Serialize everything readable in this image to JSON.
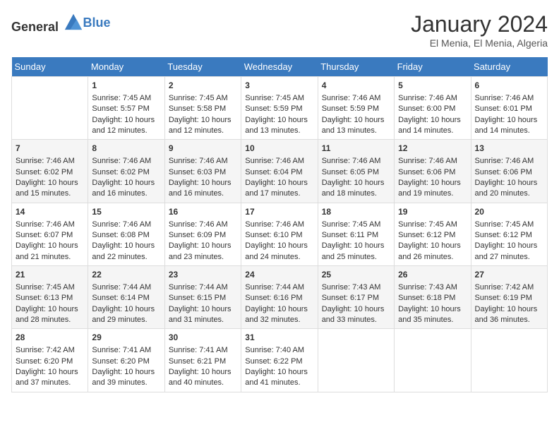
{
  "header": {
    "logo_general": "General",
    "logo_blue": "Blue",
    "month": "January 2024",
    "location": "El Menia, El Menia, Algeria"
  },
  "days_of_week": [
    "Sunday",
    "Monday",
    "Tuesday",
    "Wednesday",
    "Thursday",
    "Friday",
    "Saturday"
  ],
  "weeks": [
    [
      {
        "day": "",
        "sunrise": "",
        "sunset": "",
        "daylight": ""
      },
      {
        "day": "1",
        "sunrise": "Sunrise: 7:45 AM",
        "sunset": "Sunset: 5:57 PM",
        "daylight": "Daylight: 10 hours and 12 minutes."
      },
      {
        "day": "2",
        "sunrise": "Sunrise: 7:45 AM",
        "sunset": "Sunset: 5:58 PM",
        "daylight": "Daylight: 10 hours and 12 minutes."
      },
      {
        "day": "3",
        "sunrise": "Sunrise: 7:45 AM",
        "sunset": "Sunset: 5:59 PM",
        "daylight": "Daylight: 10 hours and 13 minutes."
      },
      {
        "day": "4",
        "sunrise": "Sunrise: 7:46 AM",
        "sunset": "Sunset: 5:59 PM",
        "daylight": "Daylight: 10 hours and 13 minutes."
      },
      {
        "day": "5",
        "sunrise": "Sunrise: 7:46 AM",
        "sunset": "Sunset: 6:00 PM",
        "daylight": "Daylight: 10 hours and 14 minutes."
      },
      {
        "day": "6",
        "sunrise": "Sunrise: 7:46 AM",
        "sunset": "Sunset: 6:01 PM",
        "daylight": "Daylight: 10 hours and 14 minutes."
      }
    ],
    [
      {
        "day": "7",
        "sunrise": "Sunrise: 7:46 AM",
        "sunset": "Sunset: 6:02 PM",
        "daylight": "Daylight: 10 hours and 15 minutes."
      },
      {
        "day": "8",
        "sunrise": "Sunrise: 7:46 AM",
        "sunset": "Sunset: 6:02 PM",
        "daylight": "Daylight: 10 hours and 16 minutes."
      },
      {
        "day": "9",
        "sunrise": "Sunrise: 7:46 AM",
        "sunset": "Sunset: 6:03 PM",
        "daylight": "Daylight: 10 hours and 16 minutes."
      },
      {
        "day": "10",
        "sunrise": "Sunrise: 7:46 AM",
        "sunset": "Sunset: 6:04 PM",
        "daylight": "Daylight: 10 hours and 17 minutes."
      },
      {
        "day": "11",
        "sunrise": "Sunrise: 7:46 AM",
        "sunset": "Sunset: 6:05 PM",
        "daylight": "Daylight: 10 hours and 18 minutes."
      },
      {
        "day": "12",
        "sunrise": "Sunrise: 7:46 AM",
        "sunset": "Sunset: 6:06 PM",
        "daylight": "Daylight: 10 hours and 19 minutes."
      },
      {
        "day": "13",
        "sunrise": "Sunrise: 7:46 AM",
        "sunset": "Sunset: 6:06 PM",
        "daylight": "Daylight: 10 hours and 20 minutes."
      }
    ],
    [
      {
        "day": "14",
        "sunrise": "Sunrise: 7:46 AM",
        "sunset": "Sunset: 6:07 PM",
        "daylight": "Daylight: 10 hours and 21 minutes."
      },
      {
        "day": "15",
        "sunrise": "Sunrise: 7:46 AM",
        "sunset": "Sunset: 6:08 PM",
        "daylight": "Daylight: 10 hours and 22 minutes."
      },
      {
        "day": "16",
        "sunrise": "Sunrise: 7:46 AM",
        "sunset": "Sunset: 6:09 PM",
        "daylight": "Daylight: 10 hours and 23 minutes."
      },
      {
        "day": "17",
        "sunrise": "Sunrise: 7:46 AM",
        "sunset": "Sunset: 6:10 PM",
        "daylight": "Daylight: 10 hours and 24 minutes."
      },
      {
        "day": "18",
        "sunrise": "Sunrise: 7:45 AM",
        "sunset": "Sunset: 6:11 PM",
        "daylight": "Daylight: 10 hours and 25 minutes."
      },
      {
        "day": "19",
        "sunrise": "Sunrise: 7:45 AM",
        "sunset": "Sunset: 6:12 PM",
        "daylight": "Daylight: 10 hours and 26 minutes."
      },
      {
        "day": "20",
        "sunrise": "Sunrise: 7:45 AM",
        "sunset": "Sunset: 6:12 PM",
        "daylight": "Daylight: 10 hours and 27 minutes."
      }
    ],
    [
      {
        "day": "21",
        "sunrise": "Sunrise: 7:45 AM",
        "sunset": "Sunset: 6:13 PM",
        "daylight": "Daylight: 10 hours and 28 minutes."
      },
      {
        "day": "22",
        "sunrise": "Sunrise: 7:44 AM",
        "sunset": "Sunset: 6:14 PM",
        "daylight": "Daylight: 10 hours and 29 minutes."
      },
      {
        "day": "23",
        "sunrise": "Sunrise: 7:44 AM",
        "sunset": "Sunset: 6:15 PM",
        "daylight": "Daylight: 10 hours and 31 minutes."
      },
      {
        "day": "24",
        "sunrise": "Sunrise: 7:44 AM",
        "sunset": "Sunset: 6:16 PM",
        "daylight": "Daylight: 10 hours and 32 minutes."
      },
      {
        "day": "25",
        "sunrise": "Sunrise: 7:43 AM",
        "sunset": "Sunset: 6:17 PM",
        "daylight": "Daylight: 10 hours and 33 minutes."
      },
      {
        "day": "26",
        "sunrise": "Sunrise: 7:43 AM",
        "sunset": "Sunset: 6:18 PM",
        "daylight": "Daylight: 10 hours and 35 minutes."
      },
      {
        "day": "27",
        "sunrise": "Sunrise: 7:42 AM",
        "sunset": "Sunset: 6:19 PM",
        "daylight": "Daylight: 10 hours and 36 minutes."
      }
    ],
    [
      {
        "day": "28",
        "sunrise": "Sunrise: 7:42 AM",
        "sunset": "Sunset: 6:20 PM",
        "daylight": "Daylight: 10 hours and 37 minutes."
      },
      {
        "day": "29",
        "sunrise": "Sunrise: 7:41 AM",
        "sunset": "Sunset: 6:20 PM",
        "daylight": "Daylight: 10 hours and 39 minutes."
      },
      {
        "day": "30",
        "sunrise": "Sunrise: 7:41 AM",
        "sunset": "Sunset: 6:21 PM",
        "daylight": "Daylight: 10 hours and 40 minutes."
      },
      {
        "day": "31",
        "sunrise": "Sunrise: 7:40 AM",
        "sunset": "Sunset: 6:22 PM",
        "daylight": "Daylight: 10 hours and 41 minutes."
      },
      {
        "day": "",
        "sunrise": "",
        "sunset": "",
        "daylight": ""
      },
      {
        "day": "",
        "sunrise": "",
        "sunset": "",
        "daylight": ""
      },
      {
        "day": "",
        "sunrise": "",
        "sunset": "",
        "daylight": ""
      }
    ]
  ]
}
